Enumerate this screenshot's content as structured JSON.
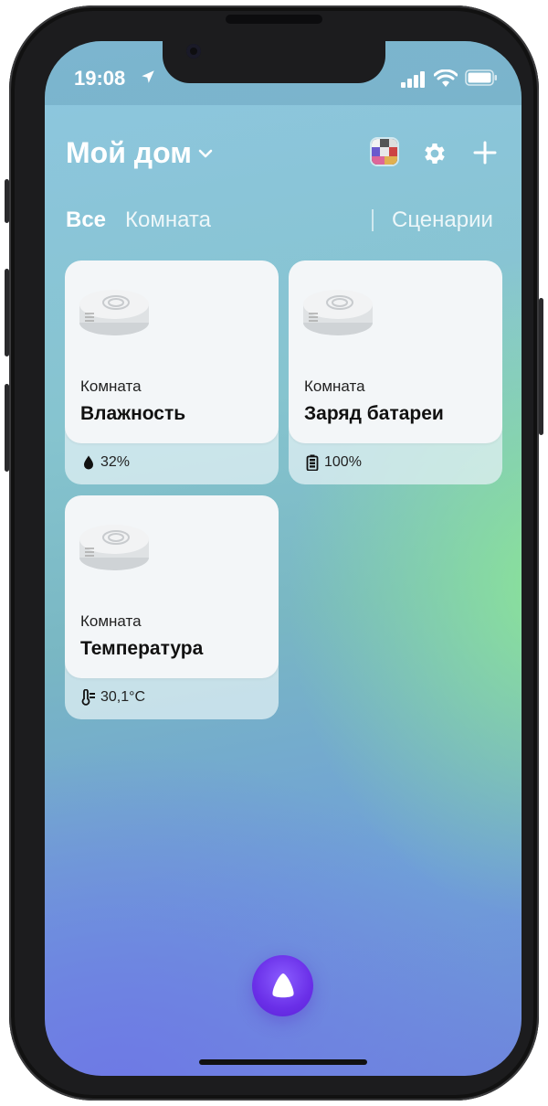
{
  "status_bar": {
    "time": "19:08"
  },
  "header": {
    "title": "Мой дом"
  },
  "tabs": [
    {
      "label": "Все",
      "active": true
    },
    {
      "label": "Комната",
      "active": false
    },
    {
      "label": "Сценарии",
      "active": false
    }
  ],
  "devices": [
    {
      "room": "Комната",
      "name": "Влажность",
      "status_icon": "drop-icon",
      "value": "32%"
    },
    {
      "room": "Комната",
      "name": "Заряд батареи",
      "status_icon": "battery-level-icon",
      "value": "100%"
    },
    {
      "room": "Комната",
      "name": "Температура",
      "status_icon": "thermometer-icon",
      "value": "30,1°C"
    }
  ],
  "colors": {
    "accent_alice": "#6a2fe8",
    "card_bg": "#f3f6f8",
    "text_primary": "#111111"
  }
}
